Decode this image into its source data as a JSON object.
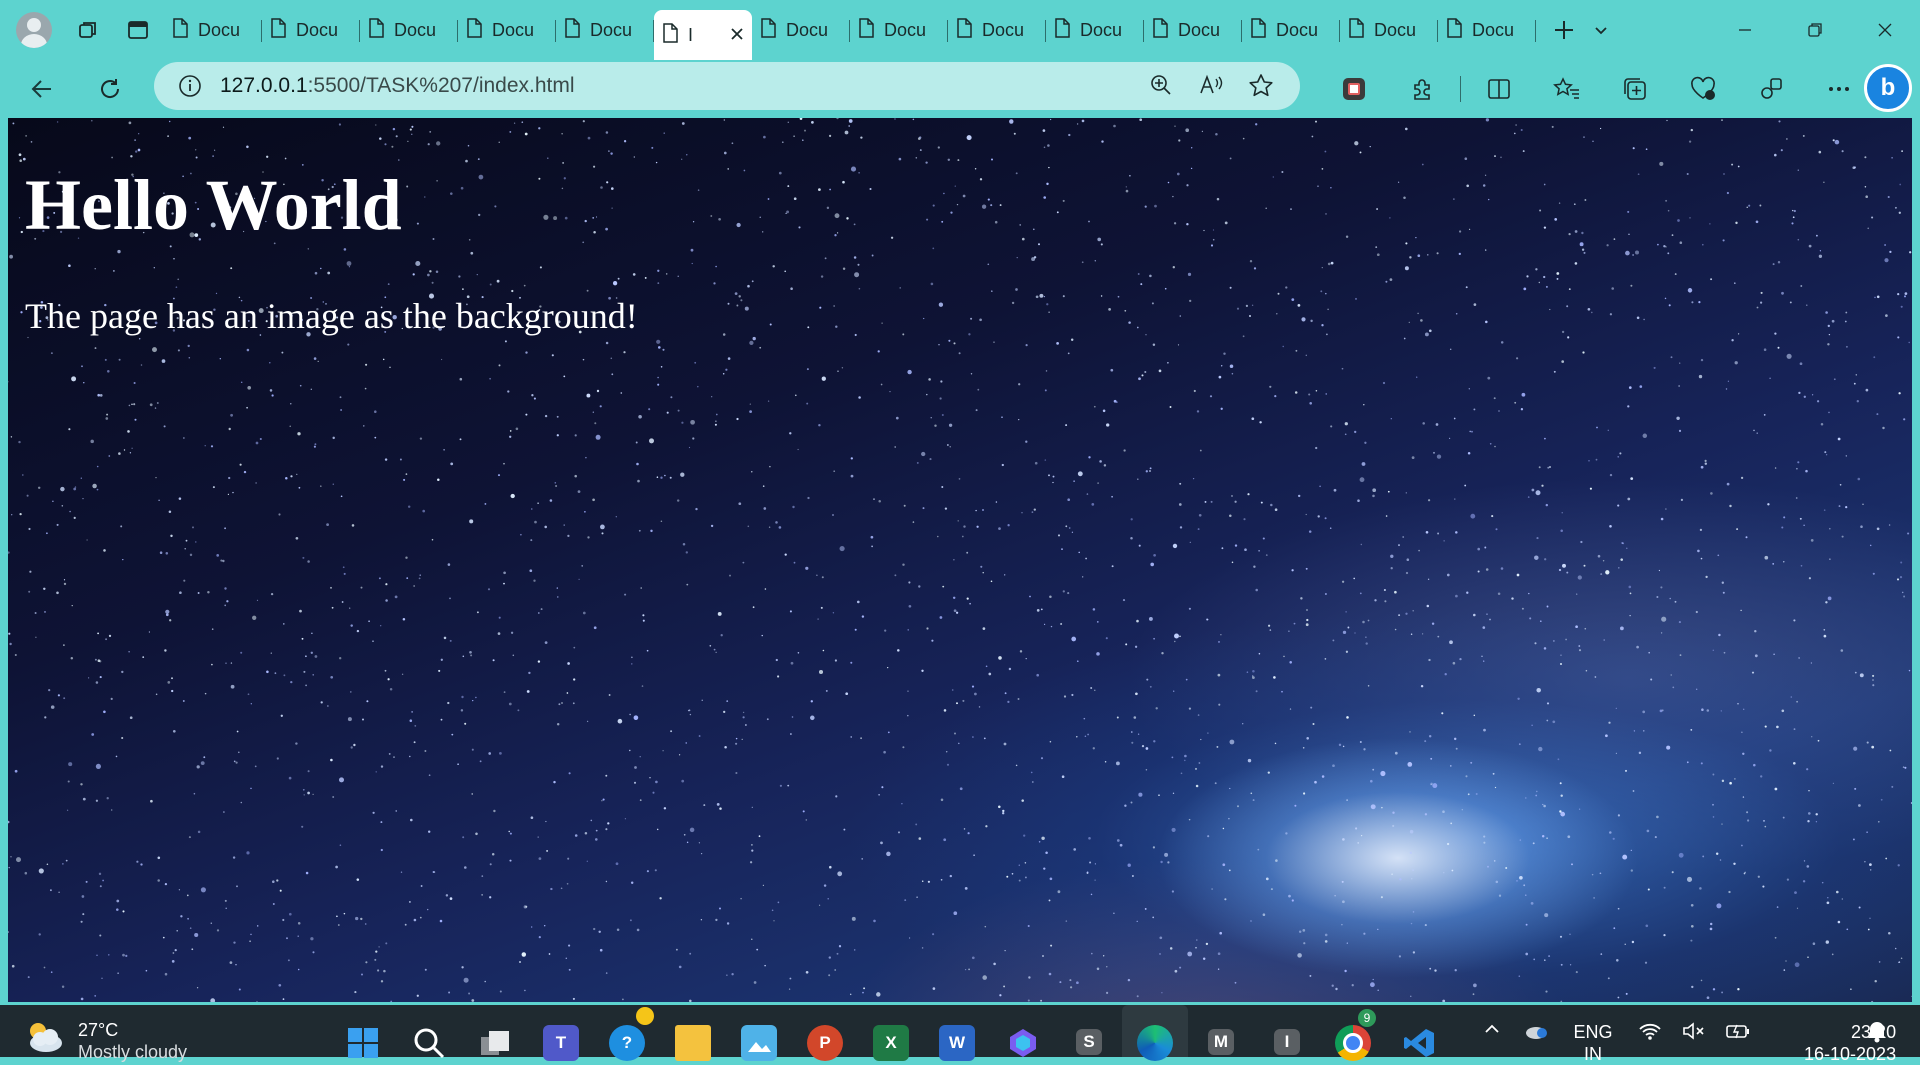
{
  "browser": {
    "tabs": [
      {
        "label": "Docu",
        "active": false
      },
      {
        "label": "Docu",
        "active": false
      },
      {
        "label": "Docu",
        "active": false
      },
      {
        "label": "Docu",
        "active": false
      },
      {
        "label": "Docu",
        "active": false
      },
      {
        "label": "I",
        "active": true
      },
      {
        "label": "Docu",
        "active": false
      },
      {
        "label": "Docu",
        "active": false
      },
      {
        "label": "Docu",
        "active": false
      },
      {
        "label": "Docu",
        "active": false
      },
      {
        "label": "Docu",
        "active": false
      },
      {
        "label": "Docu",
        "active": false
      },
      {
        "label": "Docu",
        "active": false
      },
      {
        "label": "Docu",
        "active": false
      }
    ],
    "address": {
      "host": "127.0.0.1",
      "rest": ":5500/TASK%207/index.html"
    },
    "icons": {
      "profile": "profile-avatar-icon",
      "workspaces": "workspaces-icon",
      "tab_actions": "tab-actions-icon",
      "new_tab": "plus-icon",
      "tab_list": "chevron-down-icon",
      "back": "back-arrow-icon",
      "refresh": "refresh-icon",
      "info": "info-icon",
      "zoom": "zoom-in-icon",
      "read_aloud": "read-aloud-icon",
      "favorite": "star-icon",
      "bing": "bing-copilot-icon"
    },
    "accent": "#5dd3cf"
  },
  "page": {
    "heading": "Hello World",
    "paragraph": "The page has an image as the background!"
  },
  "taskbar": {
    "weather": {
      "temp": "27°C",
      "desc": "Mostly cloudy"
    },
    "apps": [
      "windows-start",
      "search",
      "task-view",
      "teams",
      "help",
      "file-explorer",
      "photos",
      "powerpoint",
      "excel",
      "word",
      "copilot",
      "s-app",
      "edge",
      "m-app",
      "i-app",
      "chrome",
      "vscode"
    ],
    "app_letters": {
      "teams": "T",
      "powerpoint": "P",
      "excel": "X",
      "word": "W",
      "s": "S",
      "m": "M",
      "i": "I"
    },
    "chrome_badge": "9",
    "language": {
      "line1": "ENG",
      "line2": "IN"
    },
    "clock": {
      "time": "23:20",
      "date": "16-10-2023"
    }
  }
}
